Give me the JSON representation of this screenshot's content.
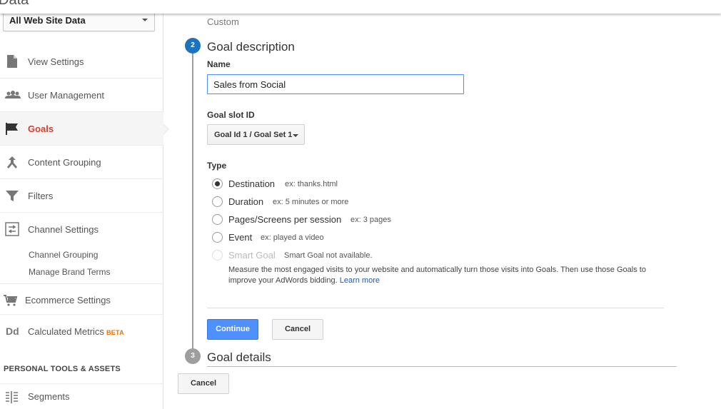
{
  "header": {
    "title_fragment": "Data"
  },
  "sidebar": {
    "view_select": "All Web Site Data",
    "items": [
      {
        "label": "View Settings",
        "icon": "document-icon"
      },
      {
        "label": "User Management",
        "icon": "users-icon"
      },
      {
        "label": "Goals",
        "icon": "flag-icon"
      },
      {
        "label": "Content Grouping",
        "icon": "merge-icon"
      },
      {
        "label": "Filters",
        "icon": "filter-icon"
      },
      {
        "label": "Channel Settings",
        "icon": "channel-settings-icon"
      },
      {
        "label": "Ecommerce Settings",
        "icon": "cart-icon"
      },
      {
        "label": "Calculated Metrics",
        "icon": "calculated-metrics-icon"
      },
      {
        "label": "Segments",
        "icon": "segments-icon"
      }
    ],
    "channel_subitems": [
      "Channel Grouping",
      "Manage Brand Terms"
    ],
    "beta_badge": "BETA",
    "personal_section": "PERSONAL TOOLS & ASSETS",
    "accent_color": "#d23f31"
  },
  "main": {
    "previous_step_value": "Custom",
    "step2": {
      "number": "2",
      "title": "Goal description"
    },
    "name": {
      "label": "Name",
      "value": "Sales from Social"
    },
    "goal_slot": {
      "label": "Goal slot ID",
      "value": "Goal Id 1 / Goal Set 1"
    },
    "type": {
      "label": "Type",
      "options": [
        {
          "label": "Destination",
          "example": "ex: thanks.html",
          "checked": true
        },
        {
          "label": "Duration",
          "example": "ex: 5 minutes or more",
          "checked": false
        },
        {
          "label": "Pages/Screens per session",
          "example": "ex: 3 pages",
          "checked": false
        },
        {
          "label": "Event",
          "example": "ex: played a video",
          "checked": false
        },
        {
          "label": "Smart Goal",
          "example": "Smart Goal not available.",
          "checked": false,
          "disabled": true
        }
      ],
      "smart_goal_description": "Measure the most engaged visits to your website and automatically turn those visits into Goals. Then use those Goals to improve your AdWords bidding.",
      "learn_more": "Learn more"
    },
    "continue_button": "Continue",
    "cancel_button": "Cancel",
    "step3": {
      "number": "3",
      "title": "Goal details"
    },
    "bottom_cancel_button": "Cancel",
    "primary_color": "#4d90fe",
    "step_active_color": "#1e73be"
  }
}
